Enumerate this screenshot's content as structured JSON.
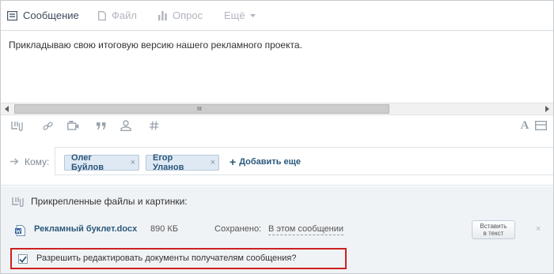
{
  "tabs": {
    "message": "Сообщение",
    "file": "Файл",
    "poll": "Опрос",
    "more": "Ещё"
  },
  "editor": {
    "text": "Прикладываю свою итоговую версию нашего рекламного проекта."
  },
  "scrollbar": {
    "grip": "III"
  },
  "toolbar": {
    "icons": [
      "attach-icon",
      "link-icon",
      "video-icon",
      "quote-icon",
      "person-icon",
      "hashtag-icon"
    ],
    "font_button": "A"
  },
  "recipients": {
    "label": "Кому:",
    "chips": [
      {
        "name": "Олег Буйлов",
        "remove": "×"
      },
      {
        "name": "Егор Уланов",
        "remove": "×"
      }
    ],
    "add_more": "Добавить еще",
    "add_symbol": "+"
  },
  "attachments": {
    "heading": "Прикрепленные файлы и картинки:",
    "file": {
      "name": "Рекламный буклет.docx",
      "size": "890 КБ",
      "saved_label": "Сохранено:",
      "saved_value": "В этом сообщении",
      "insert_line1": "Вставить",
      "insert_line2": "в текст",
      "remove": "×"
    },
    "permission": {
      "label": "Разрешить редактировать документы получателям сообщения?",
      "checked": true
    }
  },
  "colors": {
    "link": "#2b587a",
    "chip_bg": "#dfe9f4",
    "highlight_border": "#d01f1f",
    "attachments_bg": "#f0f3f6"
  }
}
